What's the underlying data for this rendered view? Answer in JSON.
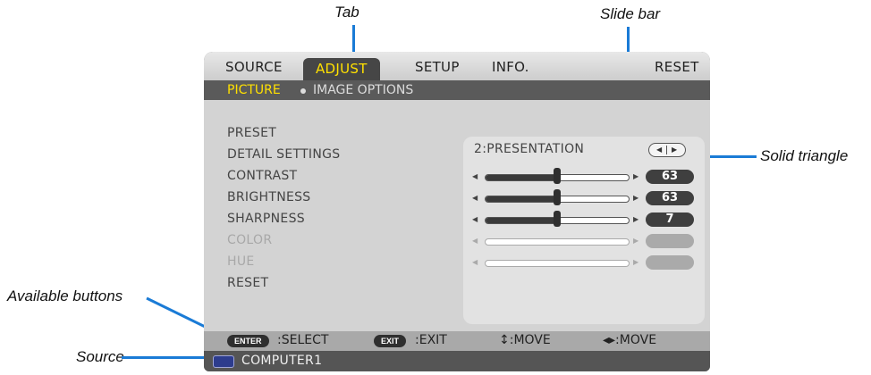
{
  "callouts": {
    "tab": "Tab",
    "slide_bar": "Slide bar",
    "solid_triangle": "Solid triangle",
    "available_buttons": "Available buttons",
    "source": "Source"
  },
  "tabs": [
    "SOURCE",
    "ADJUST",
    "SETUP",
    "INFO.",
    "RESET"
  ],
  "active_tab": "ADJUST",
  "subtabs": [
    "PICTURE",
    "IMAGE OPTIONS"
  ],
  "active_subtab": "PICTURE",
  "menu_items": [
    "PRESET",
    "DETAIL SETTINGS",
    "CONTRAST",
    "BRIGHTNESS",
    "SHARPNESS",
    "COLOR",
    "HUE",
    "RESET"
  ],
  "preset_value": "2:PRESENTATION",
  "sliders": [
    {
      "name": "CONTRAST",
      "value": "63",
      "level": 0.5,
      "enabled": true
    },
    {
      "name": "BRIGHTNESS",
      "value": "63",
      "level": 0.5,
      "enabled": true
    },
    {
      "name": "SHARPNESS",
      "value": "7",
      "level": 0.5,
      "enabled": true
    },
    {
      "name": "COLOR",
      "value": "",
      "level": 0,
      "enabled": false
    },
    {
      "name": "HUE",
      "value": "",
      "level": 0,
      "enabled": false
    }
  ],
  "footer": {
    "enter_key": "ENTER",
    "enter_action": ":SELECT",
    "exit_key": "EXIT",
    "exit_action": ":EXIT",
    "move_vertical": "↕:MOVE",
    "move_horizontal": "◂▸:MOVE"
  },
  "source_name": "COMPUTER1",
  "colors": {
    "active_tab_text": "#ffe000",
    "leader_lines": "#1a7bd6",
    "value_badge": "#3f3f3f"
  }
}
